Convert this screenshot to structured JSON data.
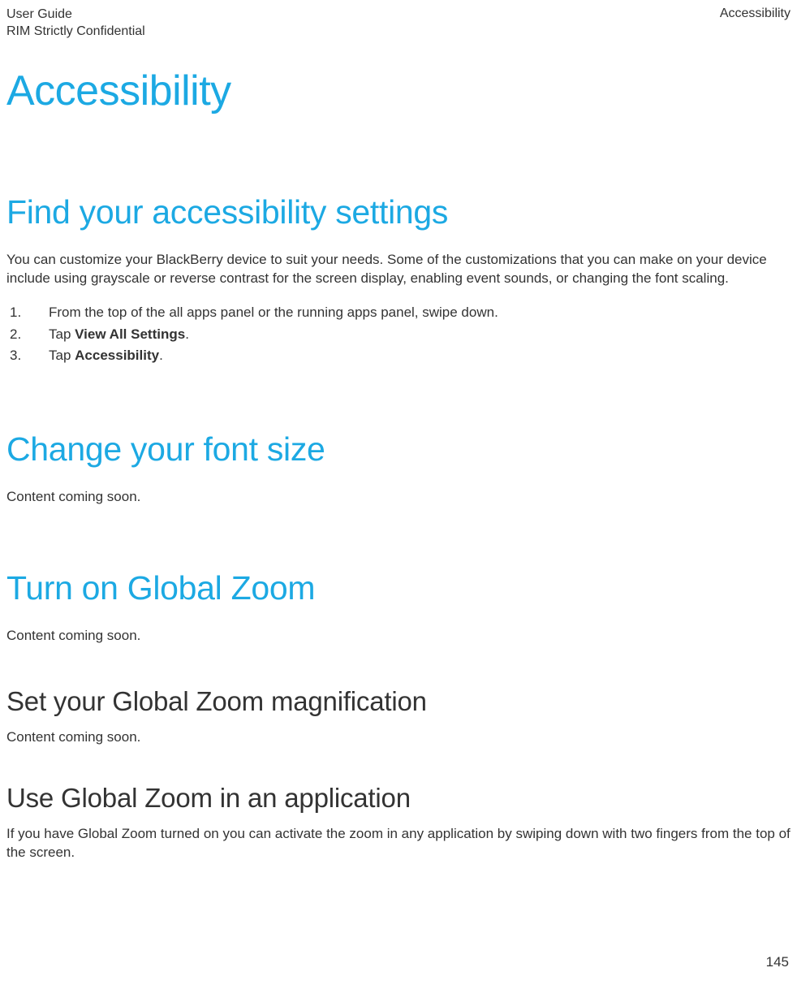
{
  "header": {
    "left_line1": "User Guide",
    "left_line2": "RIM Strictly Confidential",
    "right": "Accessibility"
  },
  "title": "Accessibility",
  "section1": {
    "heading": "Find your accessibility settings",
    "intro": "You can customize your BlackBerry device to suit your needs. Some of the customizations that you can make on your device include using grayscale or reverse contrast for the screen display, enabling event sounds, or changing the font scaling.",
    "steps": {
      "s1": "From the top of the all apps panel or the running apps panel, swipe down.",
      "s2_pre": "Tap ",
      "s2_bold": "View All Settings",
      "s2_post": ".",
      "s3_pre": "Tap ",
      "s3_bold": "Accessibility",
      "s3_post": "."
    }
  },
  "section2": {
    "heading": "Change your font size",
    "body": "Content coming soon."
  },
  "section3": {
    "heading": "Turn on Global Zoom",
    "body": "Content coming soon.",
    "sub1": {
      "heading": "Set your Global Zoom magnification",
      "body": "Content coming soon."
    },
    "sub2": {
      "heading": "Use Global Zoom in an application",
      "body": "If you have Global Zoom turned on you can activate the zoom in any application by swiping down with two fingers from the top of the screen."
    }
  },
  "page_number": "145"
}
